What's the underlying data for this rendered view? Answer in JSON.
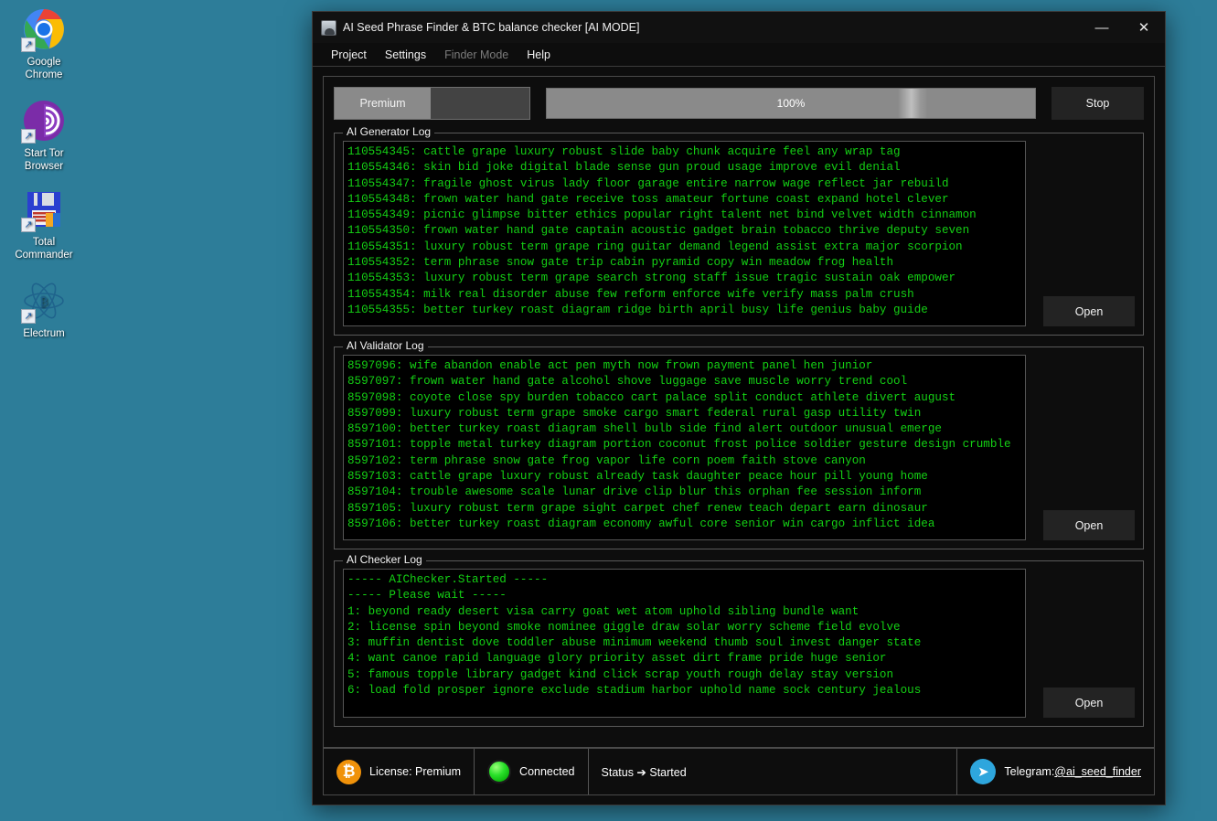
{
  "desktop": {
    "icons": [
      {
        "label": "Google\nChrome",
        "name": "chrome",
        "icon": "chrome-icon"
      },
      {
        "label": "Start Tor\nBrowser",
        "name": "tor",
        "icon": "tor-browser-icon"
      },
      {
        "label": "Total\nCommander",
        "name": "total-commander",
        "icon": "total-commander-icon"
      },
      {
        "label": "Electrum",
        "name": "electrum",
        "icon": "electrum-icon"
      }
    ]
  },
  "window": {
    "title": "AI Seed Phrase Finder & BTC balance checker [AI MODE]",
    "icon": "app-icon",
    "minimize_label": "—",
    "close_label": "✕"
  },
  "menubar": {
    "items": [
      {
        "label": "Project",
        "disabled": false
      },
      {
        "label": "Settings",
        "disabled": false
      },
      {
        "label": "Finder Mode",
        "disabled": true
      },
      {
        "label": "Help",
        "disabled": false
      }
    ]
  },
  "toolbar": {
    "premium_label": "Premium",
    "progress_percent": "100%",
    "progress_value": 100,
    "stop_label": "Stop"
  },
  "generator_log": {
    "title": "AI Generator Log",
    "open_label": "Open",
    "lines": [
      "110554345: cattle grape luxury robust slide baby chunk acquire feel any wrap tag",
      "110554346: skin bid joke digital blade sense gun proud usage improve evil denial",
      "110554347: fragile ghost virus lady floor garage entire narrow wage reflect jar rebuild",
      "110554348: frown water hand gate receive toss amateur fortune coast expand hotel clever",
      "110554349: picnic glimpse bitter ethics popular right talent net bind velvet width cinnamon",
      "110554350: frown water hand gate captain acoustic gadget brain tobacco thrive deputy seven",
      "110554351: luxury robust term grape ring guitar demand legend assist extra major scorpion",
      "110554352: term phrase snow gate trip cabin pyramid copy win meadow frog health",
      "110554353: luxury robust term grape search strong staff issue tragic sustain oak empower",
      "110554354: milk real disorder abuse few reform enforce wife verify mass palm crush",
      "110554355: better turkey roast diagram ridge birth april busy life genius baby guide"
    ]
  },
  "validator_log": {
    "title": "AI Validator Log",
    "open_label": "Open",
    "lines": [
      "8597096: wife abandon enable act pen myth now frown payment panel hen junior",
      "8597097: frown water hand gate alcohol shove luggage save muscle worry trend cool",
      "8597098: coyote close spy burden tobacco cart palace split conduct athlete divert august",
      "8597099: luxury robust term grape smoke cargo smart federal rural gasp utility twin",
      "8597100: better turkey roast diagram shell bulb side find alert outdoor unusual emerge",
      "8597101: topple metal turkey diagram portion coconut frost police soldier gesture design crumble",
      "8597102: term phrase snow gate frog vapor life corn poem faith stove canyon",
      "8597103: cattle grape luxury robust already task daughter peace hour pill young home",
      "8597104: trouble awesome scale lunar drive clip blur this orphan fee session inform",
      "8597105: luxury robust term grape sight carpet chef renew teach depart earn dinosaur",
      "8597106: better turkey roast diagram economy awful core senior win cargo inflict idea"
    ]
  },
  "checker_log": {
    "title": "AI Checker Log",
    "open_label": "Open",
    "lines": [
      "----- AIChecker.Started -----",
      "----- Please wait -----",
      "1: beyond ready desert visa carry goat wet atom uphold sibling bundle want",
      "2: license spin beyond smoke nominee giggle draw solar worry scheme field evolve",
      "3: muffin dentist dove toddler abuse minimum weekend thumb soul invest danger state",
      "4: want canoe rapid language glory priority asset dirt frame pride huge senior",
      "5: famous topple library gadget kind click scrap youth rough delay stay version",
      "6: load fold prosper ignore exclude stadium harbor uphold name sock century jealous"
    ]
  },
  "statusbar": {
    "license": "License: Premium",
    "license_icon": "bitcoin-icon",
    "connection": "Connected",
    "connection_icon": "green-led-icon",
    "status": "Status ➔ Started",
    "telegram_prefix": "Telegram: ",
    "telegram_handle": "@ai_seed_finder",
    "telegram_icon": "telegram-icon"
  },
  "colors": {
    "desktop": "#2d7d99",
    "window_bg": "#0d0d0d",
    "log_text": "#14d014",
    "accent_orange": "#f0920a",
    "accent_blue": "#2ea6dd",
    "led_green": "#2ae02a"
  }
}
